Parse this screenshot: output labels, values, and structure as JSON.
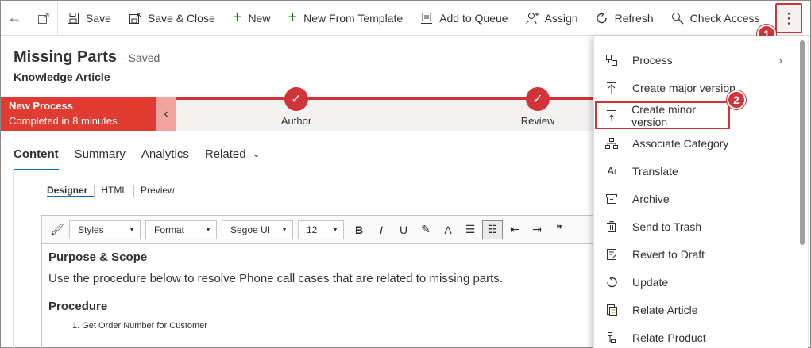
{
  "command_bar": {
    "save": "Save",
    "save_close": "Save & Close",
    "new": "New",
    "new_from_template": "New From Template",
    "add_to_queue": "Add to Queue",
    "assign": "Assign",
    "refresh": "Refresh",
    "check_access": "Check Access",
    "more_icon": "vertical-ellipsis-icon"
  },
  "callouts": [
    "1",
    "2"
  ],
  "header": {
    "title": "Missing Parts",
    "status": "- Saved",
    "entity": "Knowledge Article"
  },
  "bpf": {
    "process_name": "New Process",
    "process_time": "Completed in 8 minutes",
    "stages": [
      {
        "label": "Author"
      },
      {
        "label": "Review"
      }
    ]
  },
  "tabs": [
    "Content",
    "Summary",
    "Analytics",
    "Related"
  ],
  "editor": {
    "modes": [
      "Designer",
      "HTML",
      "Preview"
    ],
    "styles": "Styles",
    "format": "Format",
    "font": "Segoe UI",
    "size": "12",
    "heading1": "Purpose & Scope",
    "paragraph": "Use the procedure below to resolve Phone call cases that are related to missing parts.",
    "heading2": "Procedure",
    "list_item": "1. Get Order Number for Customer"
  },
  "menu": {
    "items": [
      {
        "label": "Process",
        "icon": "process-icon"
      },
      {
        "label": "Create major version",
        "icon": "major-version-icon"
      },
      {
        "label": "Create minor version",
        "icon": "minor-version-icon"
      },
      {
        "label": "Associate Category",
        "icon": "category-icon"
      },
      {
        "label": "Translate",
        "icon": "translate-icon"
      },
      {
        "label": "Archive",
        "icon": "archive-icon"
      },
      {
        "label": "Send to Trash",
        "icon": "trash-icon"
      },
      {
        "label": "Revert to Draft",
        "icon": "revert-icon"
      },
      {
        "label": "Update",
        "icon": "update-icon"
      },
      {
        "label": "Relate Article",
        "icon": "relate-article-icon"
      },
      {
        "label": "Relate Product",
        "icon": "relate-product-icon"
      }
    ]
  },
  "colors": {
    "accent_red": "#d13438",
    "process_red": "#e03c31",
    "link_blue": "#0f6cbd"
  }
}
